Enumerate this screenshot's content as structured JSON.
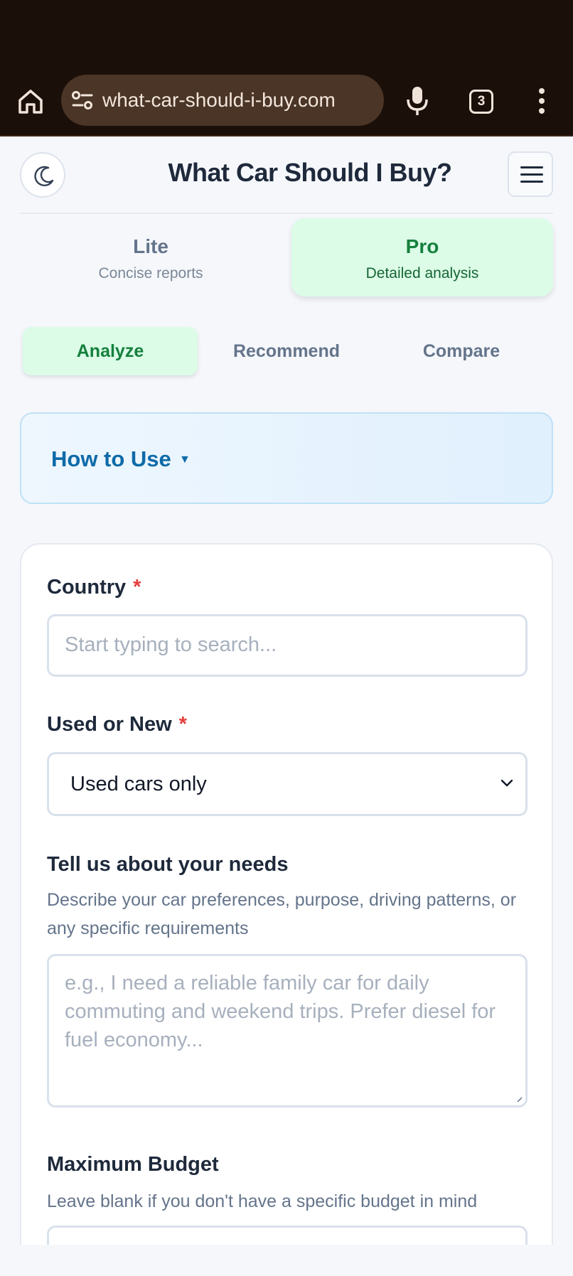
{
  "browser": {
    "url": "what-car-should-i-buy.com",
    "tab_count": "3"
  },
  "header": {
    "title": "What Car Should I Buy?"
  },
  "plans": {
    "lite": {
      "name": "Lite",
      "subtitle": "Concise reports"
    },
    "pro": {
      "name": "Pro",
      "subtitle": "Detailed analysis",
      "selected": true
    }
  },
  "modes": {
    "analyze": "Analyze",
    "recommend": "Recommend",
    "compare": "Compare",
    "selected": "Analyze"
  },
  "how_to_use": {
    "label": "How to Use",
    "caret": "▼"
  },
  "form": {
    "country": {
      "label": "Country",
      "required_mark": "*",
      "placeholder": "Start typing to search..."
    },
    "used_or_new": {
      "label": "Used or New",
      "required_mark": "*",
      "value": "Used cars only"
    },
    "needs": {
      "label": "Tell us about your needs",
      "help": "Describe your car preferences, purpose, driving patterns, or any specific requirements",
      "placeholder": "e.g., I need a reliable family car for daily commuting and weekend trips. Prefer diesel for fuel economy..."
    },
    "budget": {
      "label": "Maximum Budget",
      "help": "Leave blank if you don't have a specific budget in mind"
    }
  },
  "colors": {
    "accent_green": "#15803d",
    "accent_green_bg": "#dcfce7",
    "info_blue": "#0e6aa8",
    "required_red": "#e53e3e",
    "browser_bg": "#1b0f09"
  }
}
